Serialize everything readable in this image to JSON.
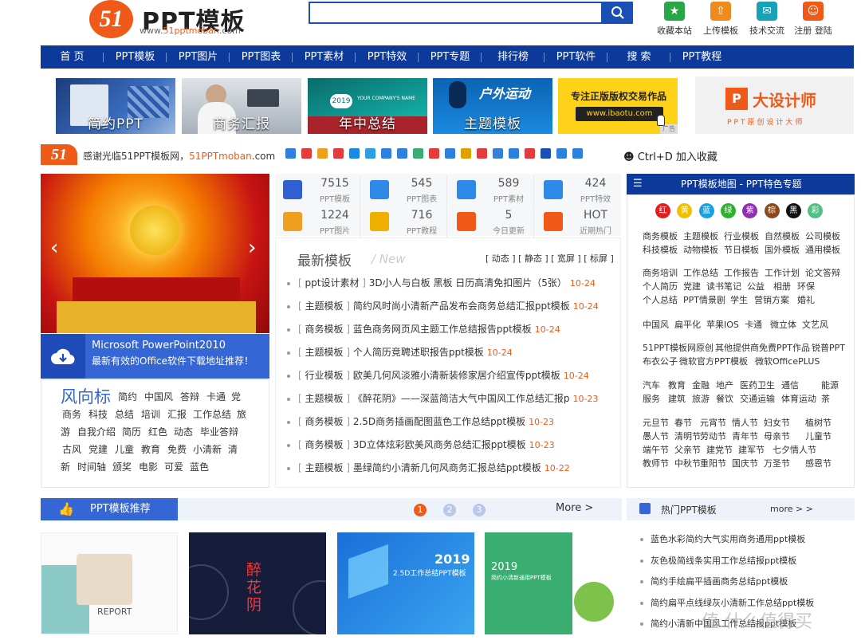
{
  "header": {
    "logo_badge": "51",
    "logo_title": "PPT模板",
    "logo_url_prefix": "www.",
    "logo_url_main": "51pptmoban",
    "logo_url_suffix": ".com",
    "search_value": "",
    "links": [
      {
        "label": "收藏本站",
        "icon": "star-icon",
        "color": "#27a745"
      },
      {
        "label": "上传模板",
        "icon": "upload-icon",
        "color": "#ef8a1c"
      },
      {
        "label": "技术交流",
        "icon": "chat-icon",
        "color": "#17a2b8"
      },
      {
        "label": "注册 登陆",
        "icon": "user-icon",
        "color": "#ef5a18"
      }
    ]
  },
  "nav": [
    "首 页",
    "PPT模板",
    "PPT图片",
    "PPT图表",
    "PPT素材",
    "PPT特效",
    "PPT专题",
    "排行榜",
    "PPT软件",
    "搜 索",
    "PPT教程"
  ],
  "banners": [
    {
      "label": "简约PPT"
    },
    {
      "label": "商务汇报"
    },
    {
      "label": "年中总结",
      "img_text": "YOUR COMPANY'S NAME",
      "year": "2019"
    },
    {
      "label": "主题模板",
      "img_text": "户外运动"
    },
    {
      "label": "",
      "line1": "专注正版版权交易作品",
      "line2": "www.ibaotu.com",
      "tag": "广告"
    },
    {
      "label": "",
      "line1": "大设计师",
      "line2": "PPT原创设计大师"
    }
  ],
  "share": {
    "logo": "51",
    "text_prefix": "感谢光临51PPT模板网，",
    "text_site": "51PPTmoban",
    "text_suffix": ".com",
    "fav": "Ctrl+D 加入收藏"
  },
  "stats": [
    {
      "n": "7515",
      "l": "PPT模板",
      "color": "#2f5fd0"
    },
    {
      "n": "545",
      "l": "PPT图表",
      "color": "#2e8ae6"
    },
    {
      "n": "589",
      "l": "PPT素材",
      "color": "#2e8ae6"
    },
    {
      "n": "424",
      "l": "PPT特效",
      "color": "#2e8ae6"
    },
    {
      "n": "1224",
      "l": "PPT图片",
      "color": "#f0a020"
    },
    {
      "n": "716",
      "l": "PPT教程",
      "color": "#f0b000"
    },
    {
      "n": "5",
      "l": "今日更新",
      "color": "#ef5a18"
    },
    {
      "n": "HOT",
      "l": "近期热门",
      "color": "#ef5a18"
    }
  ],
  "promo": {
    "title": "Microsoft PowerPoint2010",
    "sub": "最新有效的Office软件下载地址推荐！"
  },
  "tags": {
    "head": "风向标",
    "items": [
      "简约",
      "中国风",
      "答辩",
      "卡通",
      "党",
      "商务",
      "科技",
      "总结",
      "培训",
      "汇报",
      "工作总结",
      "旅",
      "游",
      "自我介绍",
      "简历",
      "红色",
      "动态",
      "毕业答辩",
      "古风",
      "党建",
      "儿童",
      "教育",
      "免费",
      "小清新",
      "清",
      "新",
      "时间轴",
      "颁奖",
      "电影",
      "可爱",
      "蓝色"
    ]
  },
  "latest": {
    "title": "最新模板",
    "title_en": "New",
    "filters": "[ 动态 ] [ 静态 ] [ 宽屏 ] [ 标屏 ]",
    "items": [
      {
        "cat": "ppt设计素材",
        "title": "3D小人与白板 黑板 日历高清免扣图片（5张）",
        "date": "10-24"
      },
      {
        "cat": "主题模板",
        "title": "简约风时尚小清新产品发布会商务总结汇报ppt模板",
        "date": "10-24"
      },
      {
        "cat": "商务模板",
        "title": "蓝色商务网页风主题工作总结报告ppt模板",
        "date": "10-24"
      },
      {
        "cat": "主题模板",
        "title": "个人简历竞聘述职报告ppt模板",
        "date": "10-24"
      },
      {
        "cat": "行业模板",
        "title": "欧美几何风淡雅小清新装修家居介绍宣传ppt模板",
        "date": "10-24"
      },
      {
        "cat": "主题模板",
        "title": "《醉花阴》——深蓝简洁大气中国风工作总结汇报p",
        "date": "10-23"
      },
      {
        "cat": "商务模板",
        "title": "2.5D商务插画配图蓝色工作总结ppt模板",
        "date": "10-23"
      },
      {
        "cat": "商务模板",
        "title": "3D立体炫彩欧美风商务总结汇报ppt模板",
        "date": "10-23"
      },
      {
        "cat": "主题模板",
        "title": "墨绿简约小清新几何风商务汇报总结ppt模板",
        "date": "10-22"
      }
    ]
  },
  "map": {
    "title": "PPT模板地图 - PPT特色专题",
    "colors": [
      {
        "l": "红",
        "c": "#e02020"
      },
      {
        "l": "黄",
        "c": "#f0c000"
      },
      {
        "l": "蓝",
        "c": "#1aa0e0"
      },
      {
        "l": "绿",
        "c": "#30b030"
      },
      {
        "l": "紫",
        "c": "#9030b0"
      },
      {
        "l": "棕",
        "c": "#8a4a20"
      },
      {
        "l": "黑",
        "c": "#111111"
      },
      {
        "l": "彩",
        "c": "#50c080"
      }
    ],
    "rows": [
      [
        "商务模板",
        "主题模板",
        "行业模板",
        "自然模板",
        "公司模板"
      ],
      [
        "科技模板",
        "动物模板",
        "节日模板",
        "国外模板",
        "通用模板"
      ],
      [
        "商务培训",
        "工作总结",
        "工作报告",
        "工作计划",
        "论文答辩"
      ],
      [
        "个人简历",
        "党建",
        "读书笔记",
        "公益",
        "相册",
        "环保"
      ],
      [
        "个人总结",
        "PPT情景剧",
        "学生",
        "营销方案",
        "婚礼"
      ],
      [
        "中国风",
        "扁平化",
        "苹果IOS",
        "卡通",
        "微立体",
        "文艺风"
      ],
      [
        "51PPT模板网原创",
        "其他提供商免费PPT作品",
        "锐普PPT"
      ],
      [
        "布衣公子",
        "微软官方PPT模板",
        "微软OfficePLUS"
      ],
      [
        "汽车",
        "教育",
        "金融",
        "地产",
        "医药卫生",
        "通信",
        "能源"
      ],
      [
        "服务",
        "建筑",
        "旅游",
        "餐饮",
        "交通运输",
        "体育运动",
        "茶"
      ],
      [
        "元旦节",
        "春节",
        "元宵节",
        "情人节",
        "妇女节",
        "植树节"
      ],
      [
        "愚人节",
        "清明节",
        "劳动节",
        "青年节",
        "母亲节",
        "儿童节"
      ],
      [
        "端午节",
        "父亲节",
        "建党节",
        "建军节",
        "七夕情人节"
      ],
      [
        "教师节",
        "中秋节",
        "重阳节",
        "国庆节",
        "万圣节",
        "感恩节"
      ]
    ]
  },
  "recommend": {
    "title": "PPT模板推荐",
    "pages": [
      "1",
      "2",
      "3"
    ],
    "more": "More >"
  },
  "hot": {
    "title": "热门PPT模板",
    "more": "more > >",
    "items": [
      "蓝色水彩简约大气实用商务通用ppt模板",
      "灰色极简线条实用工作总结报ppt模板",
      "简约手绘扁平插画商务总结ppt模板",
      "简约扁平点线绿灰小清新工作总结ppt模板",
      "简约小清新中国风工作总结报ppt模板"
    ]
  },
  "thumbs": [
    {
      "t": "REPORT"
    },
    {
      "t": "醉花阴"
    },
    {
      "t": "2019",
      "s": "2.5D工作总结PPT模板"
    },
    {
      "t": "2019",
      "s": "简约小清新通用PPT模板"
    }
  ],
  "watermark": "值 什么值得买"
}
